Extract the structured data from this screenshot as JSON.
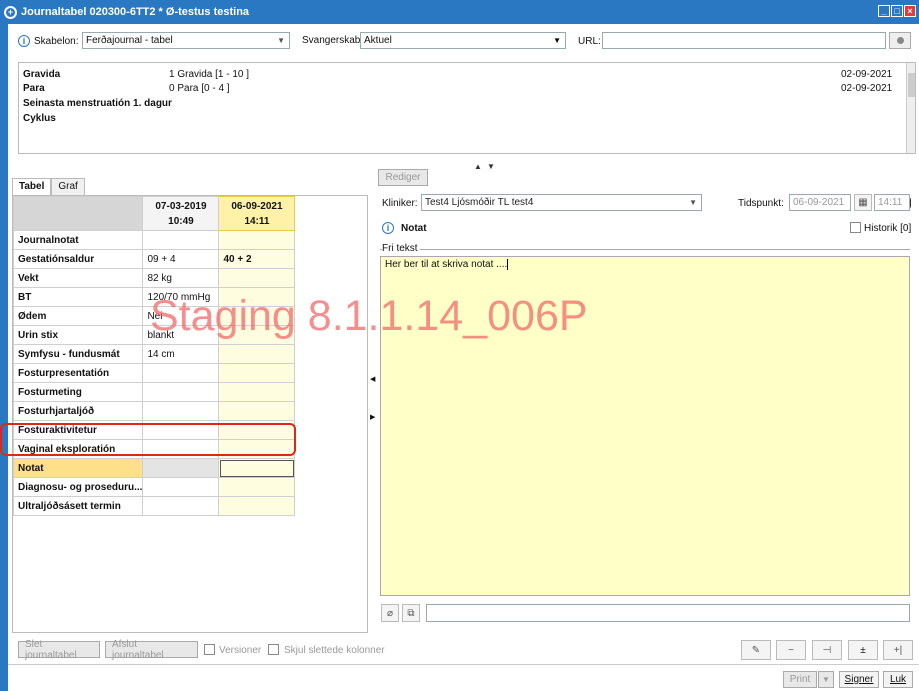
{
  "window": {
    "title": "Journaltabel 020300-6TT2 * Ø-testus testina"
  },
  "toolbar": {
    "skabelon_label": "Skabelon:",
    "skabelon_value": "Ferðajournal - tabel",
    "svangerskab_label": "Svangerskab",
    "svangerskab_value": "Aktuel",
    "url_label": "URL:"
  },
  "summary": [
    {
      "key": "Gravida",
      "value": "1 Gravida [1 - 10 ]",
      "date": "02-09-2021"
    },
    {
      "key": "Para",
      "value": "0 Para [0 - 4 ]",
      "date": "02-09-2021"
    },
    {
      "key": "Seinasta menstruatión 1. dagur",
      "value": "",
      "date": ""
    },
    {
      "key": "Cyklus",
      "value": "",
      "date": ""
    }
  ],
  "tabs": [
    {
      "label": "Tabel"
    },
    {
      "label": "Graf"
    }
  ],
  "table": {
    "columns": [
      {
        "date": "07-03-2019",
        "time": "10:49"
      },
      {
        "date": "06-09-2021",
        "time": "14:11"
      }
    ],
    "rows": [
      {
        "label": "Journalnotat",
        "c1": "",
        "c2": ""
      },
      {
        "label": "Gestatiónsaldur",
        "c1": "09 + 4",
        "c2": "40 + 2"
      },
      {
        "label": "Vekt",
        "c1": "82 kg",
        "c2": ""
      },
      {
        "label": "BT",
        "c1": "120/70 mmHg",
        "c2": ""
      },
      {
        "label": "Ødem",
        "c1": "Nei",
        "c2": ""
      },
      {
        "label": "Urin stix",
        "c1": "blankt",
        "c2": ""
      },
      {
        "label": "Symfysu - fundusmát",
        "c1": "14 cm",
        "c2": ""
      },
      {
        "label": "Fosturpresentatión",
        "c1": "",
        "c2": ""
      },
      {
        "label": "Fosturmeting",
        "c1": "",
        "c2": ""
      },
      {
        "label": "Fosturhjartaljóð",
        "c1": "",
        "c2": ""
      },
      {
        "label": "Fosturaktivitetur",
        "c1": "",
        "c2": ""
      },
      {
        "label": "Vaginal eksploratión",
        "c1": "",
        "c2": ""
      },
      {
        "label": "Notat",
        "c1": "",
        "c2": ""
      },
      {
        "label": "Diagnosu- og proseduru...",
        "c1": "",
        "c2": ""
      },
      {
        "label": "Ultraljóðsásett termin",
        "c1": "",
        "c2": ""
      }
    ]
  },
  "watermark": "Staging 8.1.1.14_006P",
  "editor": {
    "rediger_label": "Rediger",
    "kliniker_label": "Kliniker:",
    "kliniker_value": "Test4 Ljósmóðir TL test4",
    "tidspunkt_label": "Tidspunkt:",
    "tidspunkt_date": "06-09-2021",
    "tidspunkt_time": "14:11",
    "section_title": "Notat",
    "historik_label": "Historik [0]",
    "fri_tekst_label": "Fri tekst",
    "text_value": "Her ber til at skriva notat ...."
  },
  "bottom": {
    "slet_label": "Slet journaltabel",
    "afslut_label": "Afslut journaltabel",
    "versioner_label": "Versioner",
    "skjul_label": "Skjul slettede kolonner",
    "print_label": "Print",
    "signer_label": "Signer",
    "luk_label": "Luk"
  }
}
